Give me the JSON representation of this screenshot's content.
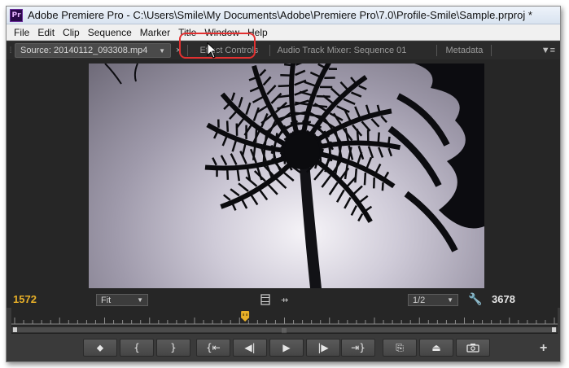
{
  "titlebar": {
    "app_icon_text": "Pr",
    "title": "Adobe Premiere Pro - C:\\Users\\Smile\\My Documents\\Adobe\\Premiere Pro\\7.0\\Profile-Smile\\Sample.prproj *"
  },
  "menu": [
    "File",
    "Edit",
    "Clip",
    "Sequence",
    "Marker",
    "Title",
    "Window",
    "Help"
  ],
  "tabs": {
    "source": "Source: 20140112_093308.mp4",
    "close": "×",
    "effect_controls": "Effect Controls",
    "audio_mixer": "Audio Track Mixer: Sequence 01",
    "metadata": "Metadata",
    "panel_menu": "▼≡"
  },
  "controls": {
    "timecode_in": "1572",
    "zoom": "Fit",
    "resolution": "1/2",
    "timecode_duration": "3678",
    "playhead_fraction": 0.427
  },
  "transport": {
    "add": "+"
  },
  "colors": {
    "highlight": "#e23030",
    "timecode_in": "#e8b028",
    "playhead": "#e8b028"
  }
}
